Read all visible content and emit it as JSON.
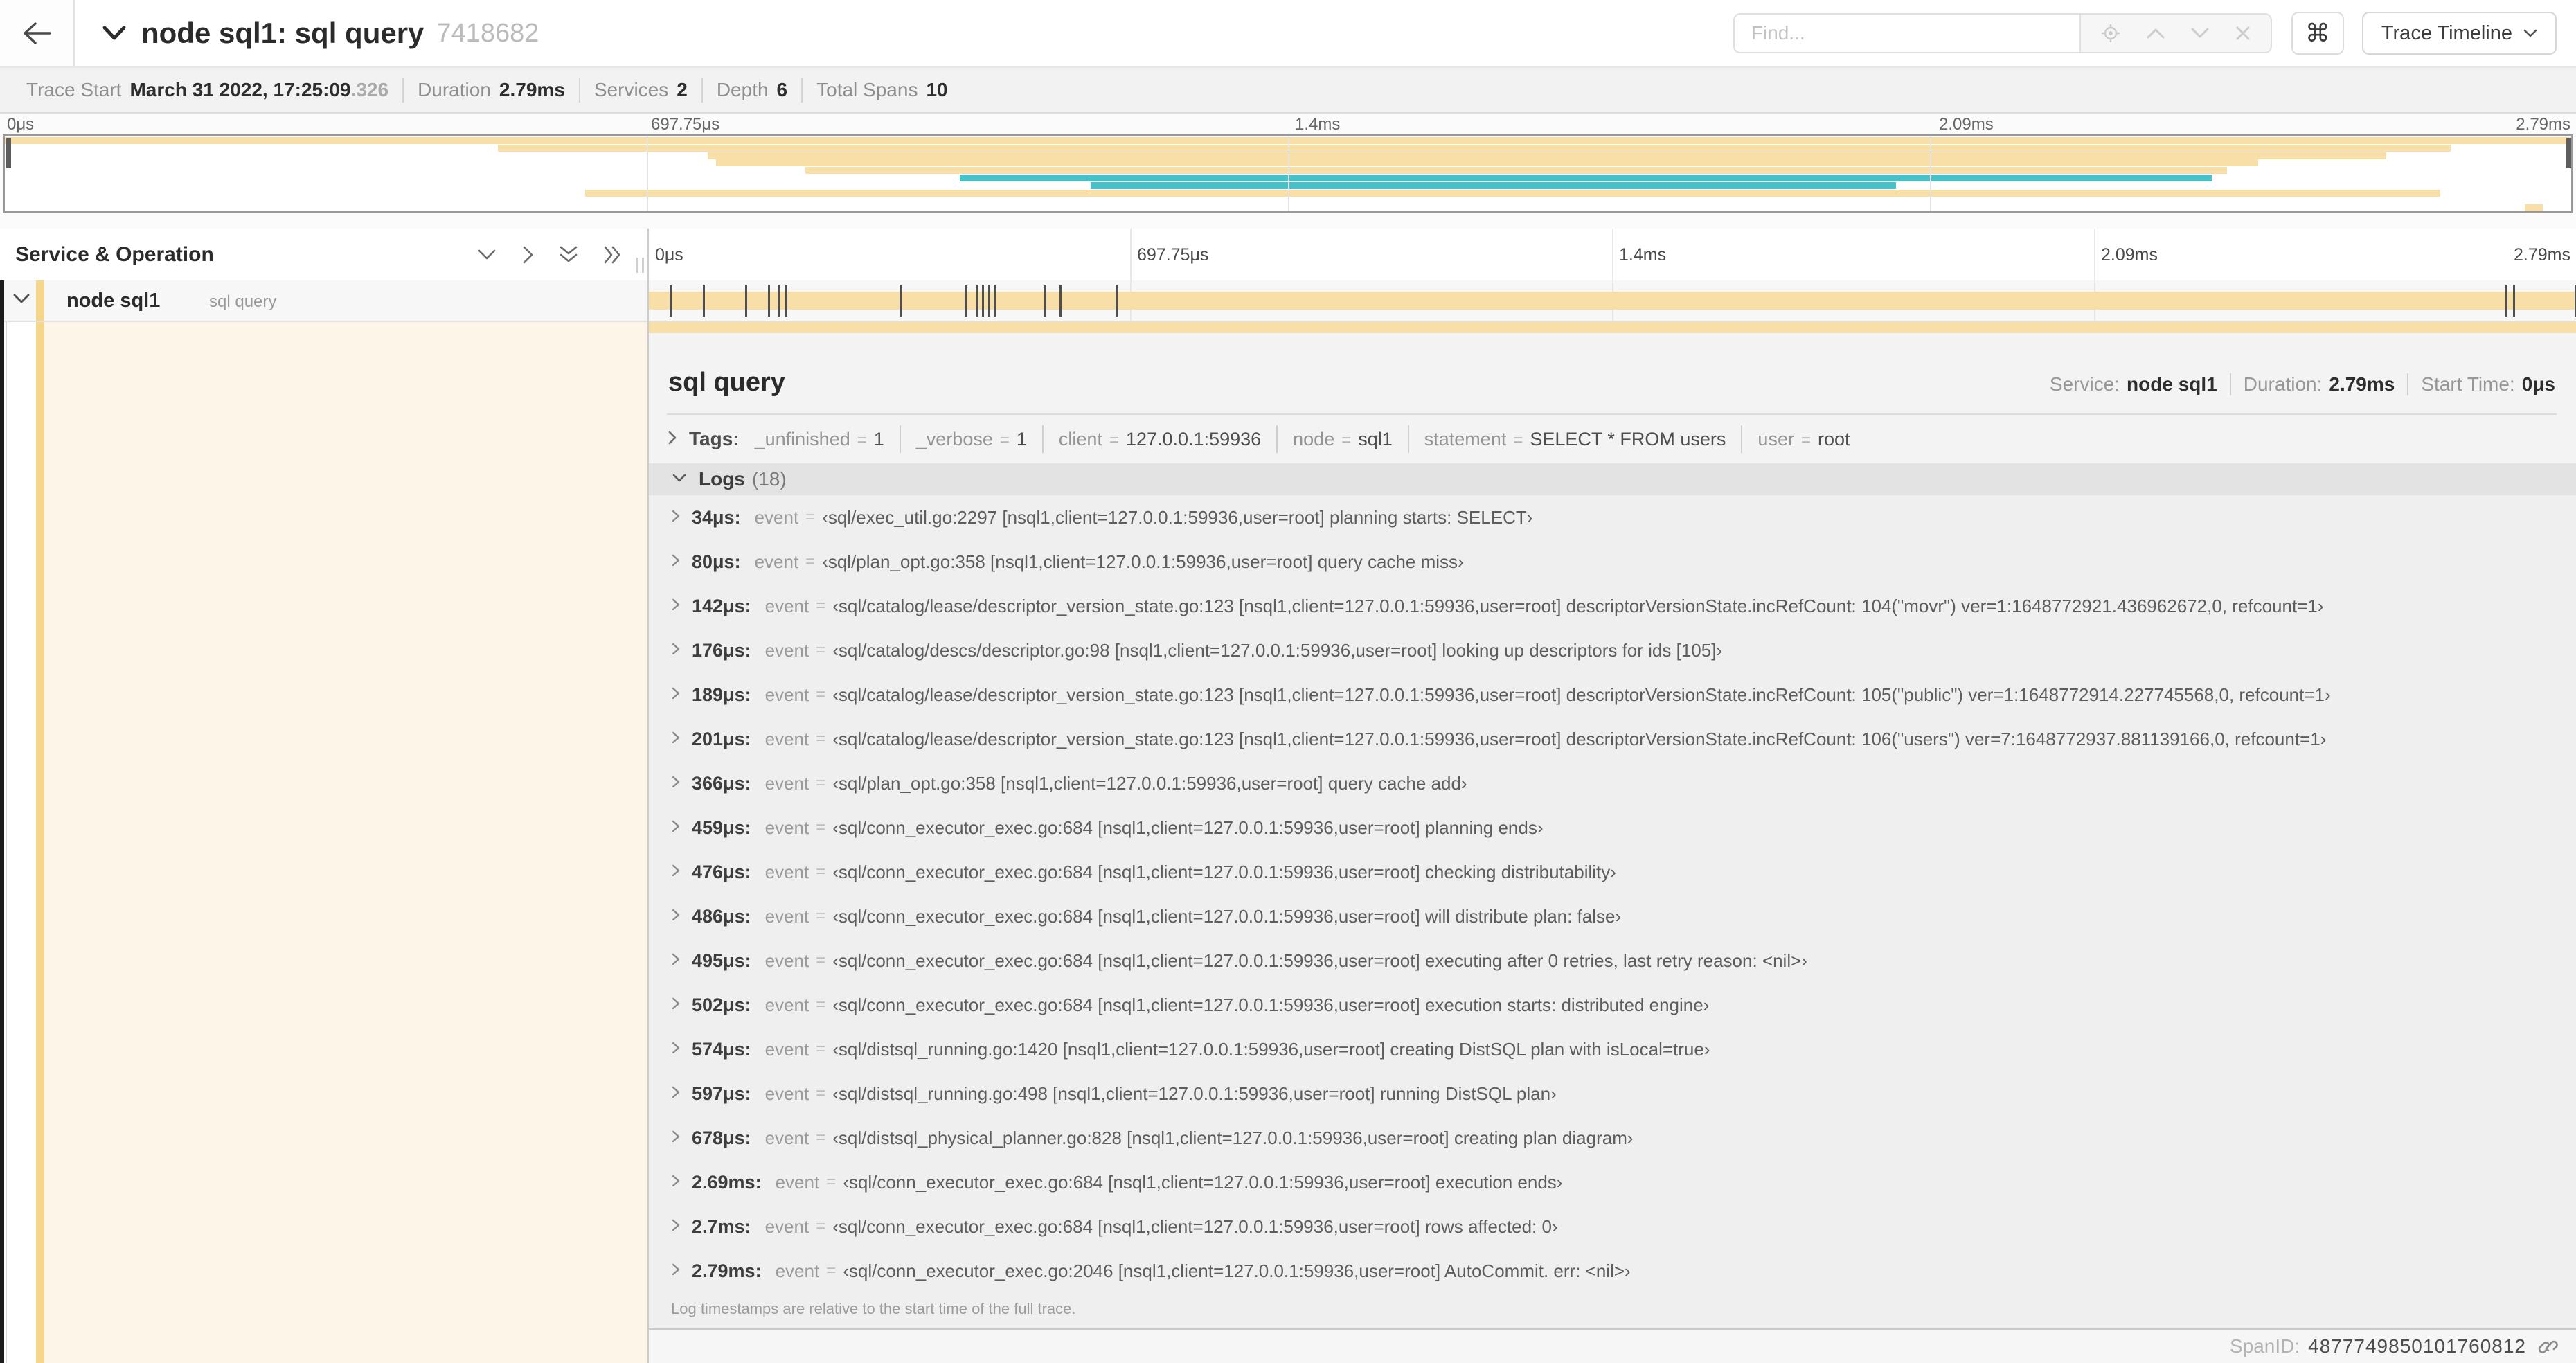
{
  "header": {
    "back_icon": "left-arrow",
    "title": "node sql1: sql query",
    "trace_id": "7418682",
    "find_placeholder": "Find...",
    "cmd_glyph": "⌘",
    "trace_timeline_label": "Trace Timeline"
  },
  "summary": {
    "items": [
      {
        "label": "Trace Start",
        "value": "March 31 2022, 17:25:09",
        "suffix": ".326"
      },
      {
        "label": "Duration",
        "value": "2.79ms"
      },
      {
        "label": "Services",
        "value": "2"
      },
      {
        "label": "Depth",
        "value": "6"
      },
      {
        "label": "Total Spans",
        "value": "10"
      }
    ]
  },
  "colors": {
    "span_yellow": "#f8dfa8",
    "span_teal": "#46c1c7",
    "service_strip_yellow": "#f5d68c",
    "child_area_cream": "#fdf5e7"
  },
  "minimap": {
    "ticks": [
      {
        "label": "0μs",
        "pos": 0,
        "align": "left"
      },
      {
        "label": "697.75μs",
        "pos": 25,
        "align": "left"
      },
      {
        "label": "1.4ms",
        "pos": 50,
        "align": "left"
      },
      {
        "label": "2.09ms",
        "pos": 75,
        "align": "left"
      },
      {
        "label": "2.79ms",
        "pos": 100,
        "align": "right"
      }
    ],
    "spans": [
      {
        "start": 0,
        "end": 100,
        "color": "yellow"
      },
      {
        "start": 19.2,
        "end": 95.3,
        "color": "yellow"
      },
      {
        "start": 27.4,
        "end": 92.8,
        "color": "yellow"
      },
      {
        "start": 27.7,
        "end": 87.8,
        "color": "yellow"
      },
      {
        "start": 31.2,
        "end": 86.6,
        "color": "yellow"
      },
      {
        "start": 37.2,
        "end": 86.0,
        "color": "teal"
      },
      {
        "start": 42.3,
        "end": 73.7,
        "color": "teal"
      },
      {
        "start": 22.6,
        "end": 94.9,
        "color": "yellow"
      },
      {
        "start": 0,
        "end": 0,
        "color": "yellow"
      },
      {
        "start": 98.2,
        "end": 98.9,
        "color": "yellow"
      }
    ]
  },
  "timeline": {
    "column_header": "Service & Operation",
    "ticks": [
      {
        "label": "0μs",
        "pos": 0,
        "align": "left"
      },
      {
        "label": "697.75μs",
        "pos": 25,
        "align": "left"
      },
      {
        "label": "1.4ms",
        "pos": 50,
        "align": "left"
      },
      {
        "label": "2.09ms",
        "pos": 75,
        "align": "left"
      },
      {
        "label": "2.79ms",
        "pos": 100,
        "align": "right"
      }
    ]
  },
  "span_row": {
    "service": "node sql1",
    "operation": "sql query",
    "log_marks_pct": [
      1.2,
      2.9,
      5.1,
      6.3,
      6.8,
      7.2,
      13.1,
      16.5,
      17.1,
      17.4,
      17.7,
      18.0,
      20.6,
      21.4,
      24.3,
      96.4,
      96.8,
      100
    ]
  },
  "detail": {
    "title": "sql query",
    "overview": {
      "service_label": "Service:",
      "service": "node sql1",
      "duration_label": "Duration:",
      "duration": "2.79ms",
      "start_label": "Start Time:",
      "start": "0μs"
    },
    "tags": {
      "label": "Tags:",
      "items": [
        {
          "key": "_unfinished",
          "value": "1"
        },
        {
          "key": "_verbose",
          "value": "1"
        },
        {
          "key": "client",
          "value": "127.0.0.1:59936"
        },
        {
          "key": "node",
          "value": "sql1"
        },
        {
          "key": "statement",
          "value": "SELECT * FROM users"
        },
        {
          "key": "user",
          "value": "root"
        }
      ]
    },
    "logs": {
      "label": "Logs",
      "count": "(18)",
      "entries": [
        {
          "time": "34μs:",
          "key": "event",
          "value": "‹sql/exec_util.go:2297 [nsql1,client=127.0.0.1:59936,user=root] planning starts: SELECT›"
        },
        {
          "time": "80μs:",
          "key": "event",
          "value": "‹sql/plan_opt.go:358 [nsql1,client=127.0.0.1:59936,user=root] query cache miss›"
        },
        {
          "time": "142μs:",
          "key": "event",
          "value": "‹sql/catalog/lease/descriptor_version_state.go:123 [nsql1,client=127.0.0.1:59936,user=root] descriptorVersionState.incRefCount: 104(\"movr\") ver=1:1648772921.436962672,0, refcount=1›"
        },
        {
          "time": "176μs:",
          "key": "event",
          "value": "‹sql/catalog/descs/descriptor.go:98 [nsql1,client=127.0.0.1:59936,user=root] looking up descriptors for ids [105]›"
        },
        {
          "time": "189μs:",
          "key": "event",
          "value": "‹sql/catalog/lease/descriptor_version_state.go:123 [nsql1,client=127.0.0.1:59936,user=root] descriptorVersionState.incRefCount: 105(\"public\") ver=1:1648772914.227745568,0, refcount=1›"
        },
        {
          "time": "201μs:",
          "key": "event",
          "value": "‹sql/catalog/lease/descriptor_version_state.go:123 [nsql1,client=127.0.0.1:59936,user=root] descriptorVersionState.incRefCount: 106(\"users\") ver=7:1648772937.881139166,0, refcount=1›"
        },
        {
          "time": "366μs:",
          "key": "event",
          "value": "‹sql/plan_opt.go:358 [nsql1,client=127.0.0.1:59936,user=root] query cache add›"
        },
        {
          "time": "459μs:",
          "key": "event",
          "value": "‹sql/conn_executor_exec.go:684 [nsql1,client=127.0.0.1:59936,user=root] planning ends›"
        },
        {
          "time": "476μs:",
          "key": "event",
          "value": "‹sql/conn_executor_exec.go:684 [nsql1,client=127.0.0.1:59936,user=root] checking distributability›"
        },
        {
          "time": "486μs:",
          "key": "event",
          "value": "‹sql/conn_executor_exec.go:684 [nsql1,client=127.0.0.1:59936,user=root] will distribute plan: false›"
        },
        {
          "time": "495μs:",
          "key": "event",
          "value": "‹sql/conn_executor_exec.go:684 [nsql1,client=127.0.0.1:59936,user=root] executing after 0 retries, last retry reason: <nil>›"
        },
        {
          "time": "502μs:",
          "key": "event",
          "value": "‹sql/conn_executor_exec.go:684 [nsql1,client=127.0.0.1:59936,user=root] execution starts: distributed engine›"
        },
        {
          "time": "574μs:",
          "key": "event",
          "value": "‹sql/distsql_running.go:1420 [nsql1,client=127.0.0.1:59936,user=root] creating DistSQL plan with isLocal=true›"
        },
        {
          "time": "597μs:",
          "key": "event",
          "value": "‹sql/distsql_running.go:498 [nsql1,client=127.0.0.1:59936,user=root] running DistSQL plan›"
        },
        {
          "time": "678μs:",
          "key": "event",
          "value": "‹sql/distsql_physical_planner.go:828 [nsql1,client=127.0.0.1:59936,user=root] creating plan diagram›"
        },
        {
          "time": "2.69ms:",
          "key": "event",
          "value": "‹sql/conn_executor_exec.go:684 [nsql1,client=127.0.0.1:59936,user=root] execution ends›"
        },
        {
          "time": "2.7ms:",
          "key": "event",
          "value": "‹sql/conn_executor_exec.go:684 [nsql1,client=127.0.0.1:59936,user=root] rows affected: 0›"
        },
        {
          "time": "2.79ms:",
          "key": "event",
          "value": "‹sql/conn_executor_exec.go:2046 [nsql1,client=127.0.0.1:59936,user=root] AutoCommit. err: <nil>›"
        }
      ],
      "footnote": "Log timestamps are relative to the start time of the full trace."
    }
  },
  "footer": {
    "span_id_label": "SpanID:",
    "span_id": "4877749850101760812"
  }
}
